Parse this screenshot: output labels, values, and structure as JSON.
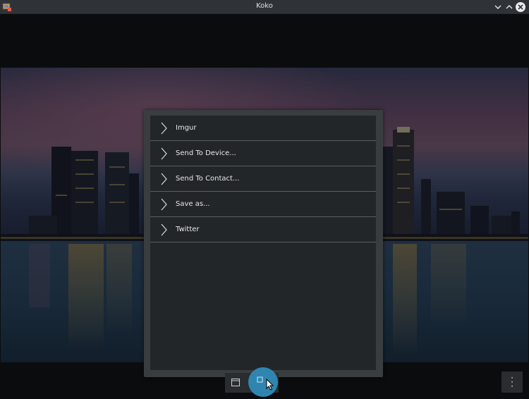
{
  "window": {
    "title": "Koko",
    "app_icon": "koko-app-icon",
    "controls": [
      "minimize-icon",
      "maximize-icon",
      "close-icon"
    ]
  },
  "share_menu": {
    "items": [
      {
        "label": "Imgur",
        "icon": "chevron-right-icon"
      },
      {
        "label": "Send To Device...",
        "icon": "chevron-right-icon"
      },
      {
        "label": "Send To Contact...",
        "icon": "chevron-right-icon"
      },
      {
        "label": "Save as...",
        "icon": "chevron-right-icon"
      },
      {
        "label": "Twitter",
        "icon": "chevron-right-icon"
      }
    ]
  },
  "bottom_bar": {
    "icons": [
      "slideshow-icon",
      "share-icon",
      "overflow-menu-icon"
    ]
  },
  "colors": {
    "titlebar": "#2f3337",
    "dialog": "#3a3d40",
    "list_bg": "#232628",
    "accent": "#2f85b0"
  }
}
